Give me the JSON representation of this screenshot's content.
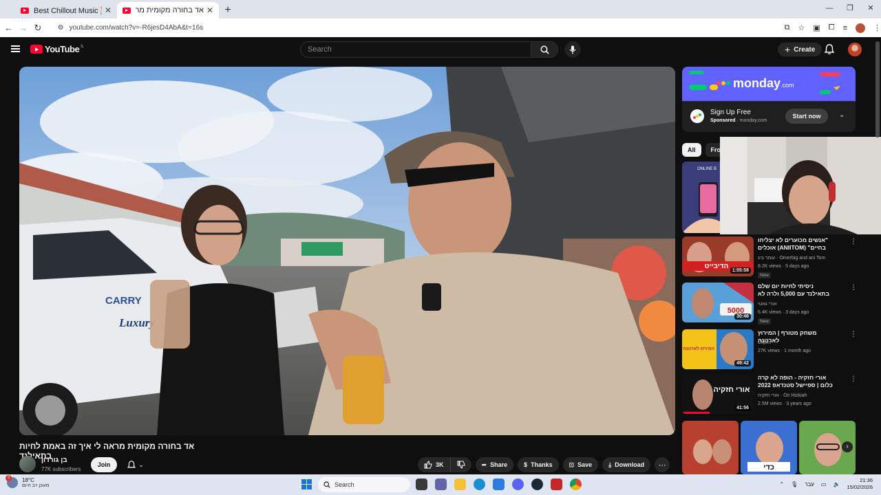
{
  "browser": {
    "tabs": [
      {
        "title": "Best Chillout Music 🌅 LOUNGE",
        "active": false
      },
      {
        "title": "אד בחורה מקומית מראה לי איך זה",
        "active": true
      }
    ],
    "new_tab": "+",
    "url": "youtube.com/watch?v=-R6jesD4AbA&t=16s",
    "window_controls": [
      "—",
      "❐",
      "✕"
    ]
  },
  "youtube": {
    "logo_text": "YouTube",
    "logo_superscript": "IL",
    "search_placeholder": "Search",
    "create_label": "Create"
  },
  "video": {
    "title": "אד בחורה מקומית מראה לי איך זה באמת לחיות בתאילנד",
    "channel_name": "בן גורדון",
    "subscribers": "77K subscribers",
    "join_label": "Join",
    "likes": "3K",
    "share_label": "Share",
    "thanks_label": "Thanks",
    "save_label": "Save",
    "download_label": "Download",
    "scene_sign_text": "CARRY",
    "scene_sign_text2": "Luxury"
  },
  "ad": {
    "brand": "monday",
    "brand_suffix": ".com",
    "title": "Sign Up Free",
    "sponsored": "Sponsored",
    "domain": "monday.com",
    "cta": "Start now",
    "accent": "#6161ff"
  },
  "chips": [
    "All",
    "From"
  ],
  "top_thumb_label": "ONLINE B",
  "recommendations": [
    {
      "title": "\"אנשים מכוערים לא יצליחו בחיים\" (ANIITOM) אוכלים בגדול",
      "channel": "עומר ביג · Omerbig and ani Tom",
      "meta": "8.2K views · 5 days ago",
      "badge": "New",
      "duration": "1:05:58",
      "thumb_text": "הדיבייט"
    },
    {
      "title": "ניסיתי לחיות יום שלם בתאילנד עם 5,000 ולרה לא ציפיתי",
      "channel": "אורי גאטי",
      "meta": "6.4K views · 3 days ago",
      "badge": "New",
      "duration": "30:46",
      "thumb_text": "5000"
    },
    {
      "title": "משחק מטורף | המירוץ לארנונה",
      "channel": "Clipim",
      "meta": "27K views · 1 month ago",
      "badge": "",
      "duration": "49:42",
      "thumb_text": "המירוץ לארנונה"
    },
    {
      "title": "אורי חזקיה - הופה לא קרה כלום | ספיישל סטנדאפ 2022",
      "channel": "אורי חזקיה · Ori Hizkiah",
      "meta": "2.5M views · 3 years ago",
      "badge": "",
      "duration": "41:56",
      "thumb_text": "אורי חזקיה"
    }
  ],
  "shorts_label": "כדי",
  "taskbar": {
    "temp": "18°C",
    "weather_text": "מעונן רב היום",
    "weather_badge": "3",
    "search_label": "Search",
    "lang": "עבר",
    "time": "21:36",
    "date": "15/02/2026"
  }
}
